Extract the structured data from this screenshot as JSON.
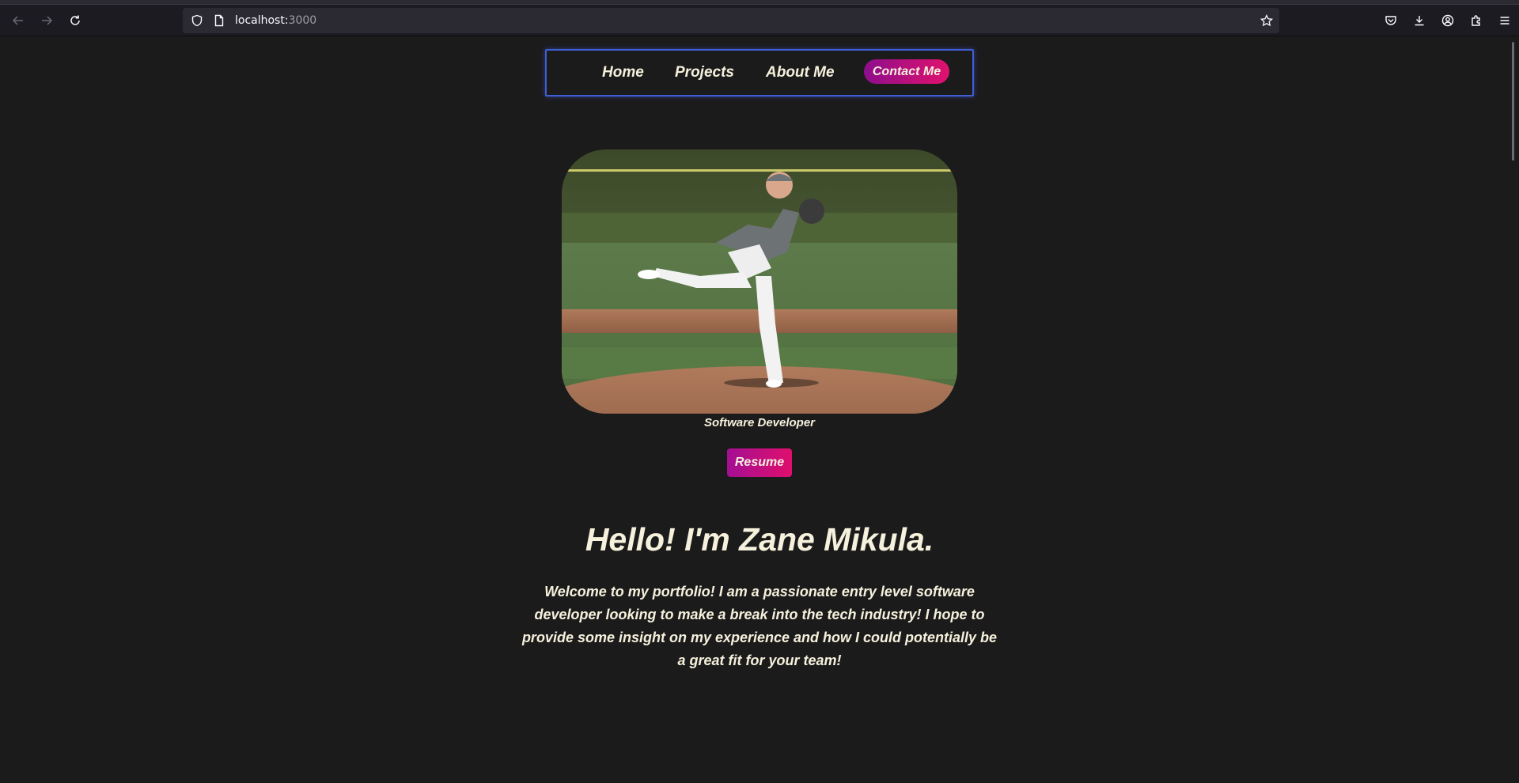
{
  "browser": {
    "url_host": "localhost:",
    "url_port": "3000"
  },
  "nav": {
    "home": "Home",
    "projects": "Projects",
    "about": "About Me",
    "contact": "Contact Me"
  },
  "hero": {
    "role": "Software Developer",
    "resume_label": "Resume",
    "greeting": "Hello! I'm Zane Mikula.",
    "intro": "Welcome to my portfolio! I am a passionate entry level software developer looking to make a break into the tech industry! I hope to provide some insight on my experience and how I could potentially be a great fit for your team!"
  },
  "colors": {
    "background": "#1c1b1c",
    "text": "#f5f1dc",
    "nav_border": "#3f5ed6",
    "accent_start": "#8e0e8c",
    "accent_end": "#e0116d"
  },
  "icons": [
    "back-icon",
    "forward-icon",
    "reload-icon",
    "shield-icon",
    "page-icon",
    "bookmark-star-icon",
    "pocket-icon",
    "download-icon",
    "account-icon",
    "extensions-icon",
    "menu-icon"
  ]
}
